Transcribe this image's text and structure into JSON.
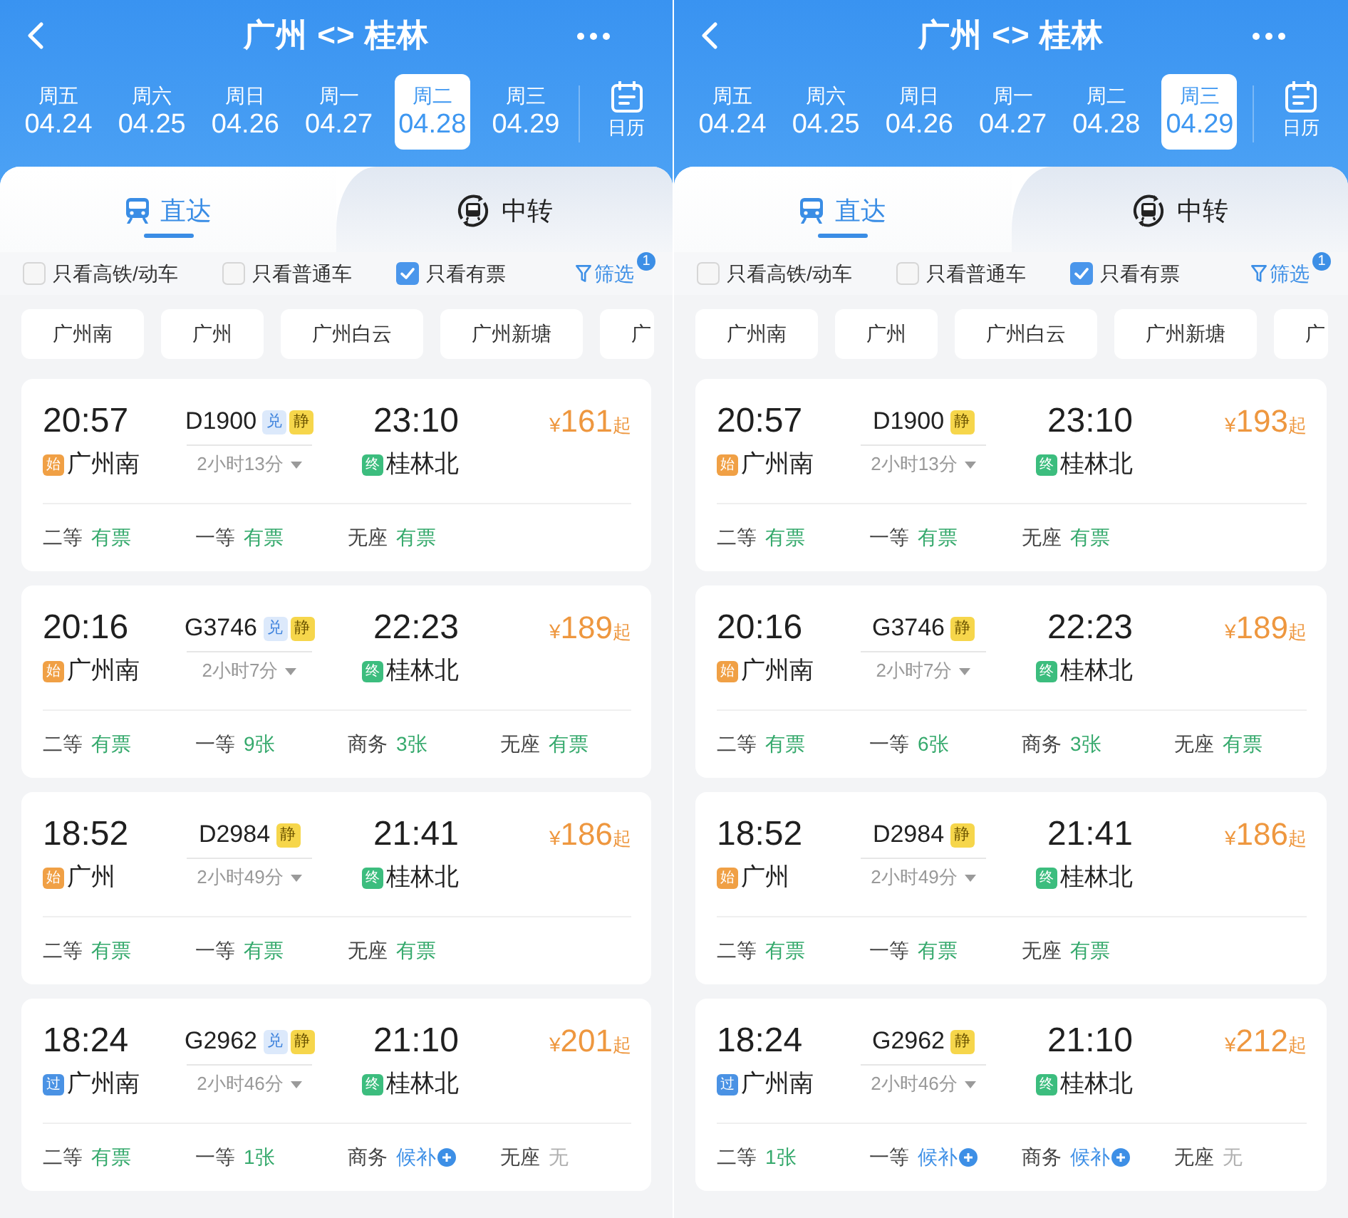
{
  "panels": [
    {
      "header": {
        "title": "广州 <> 桂林"
      },
      "dates": [
        {
          "weekday": "周五",
          "date": "04.24",
          "selected": false
        },
        {
          "weekday": "周六",
          "date": "04.25",
          "selected": false
        },
        {
          "weekday": "周日",
          "date": "04.26",
          "selected": false
        },
        {
          "weekday": "周一",
          "date": "04.27",
          "selected": false
        },
        {
          "weekday": "周二",
          "date": "04.28",
          "selected": true
        },
        {
          "weekday": "周三",
          "date": "04.29",
          "selected": false
        }
      ],
      "calendar": {
        "label": "日历"
      },
      "tabs": [
        {
          "kind": "direct",
          "label": "直达",
          "selected": true
        },
        {
          "kind": "transfer",
          "label": "中转",
          "selected": false
        }
      ],
      "filters": [
        {
          "label": "只看高铁/动车",
          "checked": false
        },
        {
          "label": "只看普通车",
          "checked": false
        },
        {
          "label": "只看有票",
          "checked": true
        }
      ],
      "filter_button": {
        "label": "筛选",
        "badge": "1"
      },
      "stations": [
        {
          "label": "广州南",
          "selected": false
        },
        {
          "label": "广州",
          "selected": false
        },
        {
          "label": "广州白云",
          "selected": false
        },
        {
          "label": "广州新塘",
          "selected": false
        },
        {
          "label": "广",
          "selected": false
        }
      ],
      "trains": [
        {
          "depart": "20:57",
          "from": {
            "tag": "始",
            "kind": "origin",
            "station": "广州南"
          },
          "number": "D1900",
          "badges": [
            {
              "kind": "exchange",
              "text": "兑"
            },
            {
              "kind": "quiet",
              "text": "静"
            }
          ],
          "duration": "2小时13分",
          "arrive": "23:10",
          "to": {
            "tag": "终",
            "kind": "terminal",
            "station": "桂林北"
          },
          "price": {
            "currency": "¥",
            "amount": "161",
            "suffix": "起"
          },
          "seats": [
            {
              "class": "二等",
              "status": "有票",
              "kind": "available"
            },
            {
              "class": "一等",
              "status": "有票",
              "kind": "available"
            },
            {
              "class": "无座",
              "status": "有票",
              "kind": "available"
            }
          ]
        },
        {
          "depart": "20:16",
          "from": {
            "tag": "始",
            "kind": "origin",
            "station": "广州南"
          },
          "number": "G3746",
          "badges": [
            {
              "kind": "exchange",
              "text": "兑"
            },
            {
              "kind": "quiet",
              "text": "静"
            }
          ],
          "duration": "2小时7分",
          "arrive": "22:23",
          "to": {
            "tag": "终",
            "kind": "terminal",
            "station": "桂林北"
          },
          "price": {
            "currency": "¥",
            "amount": "189",
            "suffix": "起"
          },
          "seats": [
            {
              "class": "二等",
              "status": "有票",
              "kind": "available"
            },
            {
              "class": "一等",
              "status": "9张",
              "kind": "available"
            },
            {
              "class": "商务",
              "status": "3张",
              "kind": "available"
            },
            {
              "class": "无座",
              "status": "有票",
              "kind": "available"
            }
          ]
        },
        {
          "depart": "18:52",
          "from": {
            "tag": "始",
            "kind": "origin",
            "station": "广州"
          },
          "number": "D2984",
          "badges": [
            {
              "kind": "quiet",
              "text": "静"
            }
          ],
          "duration": "2小时49分",
          "arrive": "21:41",
          "to": {
            "tag": "终",
            "kind": "terminal",
            "station": "桂林北"
          },
          "price": {
            "currency": "¥",
            "amount": "186",
            "suffix": "起"
          },
          "seats": [
            {
              "class": "二等",
              "status": "有票",
              "kind": "available"
            },
            {
              "class": "一等",
              "status": "有票",
              "kind": "available"
            },
            {
              "class": "无座",
              "status": "有票",
              "kind": "available"
            }
          ]
        },
        {
          "depart": "18:24",
          "from": {
            "tag": "过",
            "kind": "pass",
            "station": "广州南"
          },
          "number": "G2962",
          "badges": [
            {
              "kind": "exchange",
              "text": "兑"
            },
            {
              "kind": "quiet",
              "text": "静"
            }
          ],
          "duration": "2小时46分",
          "arrive": "21:10",
          "to": {
            "tag": "终",
            "kind": "terminal",
            "station": "桂林北"
          },
          "price": {
            "currency": "¥",
            "amount": "201",
            "suffix": "起"
          },
          "seats": [
            {
              "class": "二等",
              "status": "有票",
              "kind": "available"
            },
            {
              "class": "一等",
              "status": "1张",
              "kind": "available"
            },
            {
              "class": "商务",
              "status": "候补",
              "kind": "waitlist"
            },
            {
              "class": "无座",
              "status": "无",
              "kind": "none"
            }
          ]
        }
      ]
    },
    {
      "header": {
        "title": "广州 <> 桂林"
      },
      "dates": [
        {
          "weekday": "周五",
          "date": "04.24",
          "selected": false
        },
        {
          "weekday": "周六",
          "date": "04.25",
          "selected": false
        },
        {
          "weekday": "周日",
          "date": "04.26",
          "selected": false
        },
        {
          "weekday": "周一",
          "date": "04.27",
          "selected": false
        },
        {
          "weekday": "周二",
          "date": "04.28",
          "selected": false
        },
        {
          "weekday": "周三",
          "date": "04.29",
          "selected": true
        }
      ],
      "calendar": {
        "label": "日历"
      },
      "tabs": [
        {
          "kind": "direct",
          "label": "直达",
          "selected": true
        },
        {
          "kind": "transfer",
          "label": "中转",
          "selected": false
        }
      ],
      "filters": [
        {
          "label": "只看高铁/动车",
          "checked": false
        },
        {
          "label": "只看普通车",
          "checked": false
        },
        {
          "label": "只看有票",
          "checked": true
        }
      ],
      "filter_button": {
        "label": "筛选",
        "badge": "1"
      },
      "stations": [
        {
          "label": "广州南",
          "selected": false
        },
        {
          "label": "广州",
          "selected": false
        },
        {
          "label": "广州白云",
          "selected": false
        },
        {
          "label": "广州新塘",
          "selected": false
        },
        {
          "label": "广",
          "selected": false
        }
      ],
      "trains": [
        {
          "depart": "20:57",
          "from": {
            "tag": "始",
            "kind": "origin",
            "station": "广州南"
          },
          "number": "D1900",
          "badges": [
            {
              "kind": "quiet",
              "text": "静"
            }
          ],
          "duration": "2小时13分",
          "arrive": "23:10",
          "to": {
            "tag": "终",
            "kind": "terminal",
            "station": "桂林北"
          },
          "price": {
            "currency": "¥",
            "amount": "193",
            "suffix": "起"
          },
          "seats": [
            {
              "class": "二等",
              "status": "有票",
              "kind": "available"
            },
            {
              "class": "一等",
              "status": "有票",
              "kind": "available"
            },
            {
              "class": "无座",
              "status": "有票",
              "kind": "available"
            }
          ]
        },
        {
          "depart": "20:16",
          "from": {
            "tag": "始",
            "kind": "origin",
            "station": "广州南"
          },
          "number": "G3746",
          "badges": [
            {
              "kind": "quiet",
              "text": "静"
            }
          ],
          "duration": "2小时7分",
          "arrive": "22:23",
          "to": {
            "tag": "终",
            "kind": "terminal",
            "station": "桂林北"
          },
          "price": {
            "currency": "¥",
            "amount": "189",
            "suffix": "起"
          },
          "seats": [
            {
              "class": "二等",
              "status": "有票",
              "kind": "available"
            },
            {
              "class": "一等",
              "status": "6张",
              "kind": "available"
            },
            {
              "class": "商务",
              "status": "3张",
              "kind": "available"
            },
            {
              "class": "无座",
              "status": "有票",
              "kind": "available"
            }
          ]
        },
        {
          "depart": "18:52",
          "from": {
            "tag": "始",
            "kind": "origin",
            "station": "广州"
          },
          "number": "D2984",
          "badges": [
            {
              "kind": "quiet",
              "text": "静"
            }
          ],
          "duration": "2小时49分",
          "arrive": "21:41",
          "to": {
            "tag": "终",
            "kind": "terminal",
            "station": "桂林北"
          },
          "price": {
            "currency": "¥",
            "amount": "186",
            "suffix": "起"
          },
          "seats": [
            {
              "class": "二等",
              "status": "有票",
              "kind": "available"
            },
            {
              "class": "一等",
              "status": "有票",
              "kind": "available"
            },
            {
              "class": "无座",
              "status": "有票",
              "kind": "available"
            }
          ]
        },
        {
          "depart": "18:24",
          "from": {
            "tag": "过",
            "kind": "pass",
            "station": "广州南"
          },
          "number": "G2962",
          "badges": [
            {
              "kind": "quiet",
              "text": "静"
            }
          ],
          "duration": "2小时46分",
          "arrive": "21:10",
          "to": {
            "tag": "终",
            "kind": "terminal",
            "station": "桂林北"
          },
          "price": {
            "currency": "¥",
            "amount": "212",
            "suffix": "起"
          },
          "seats": [
            {
              "class": "二等",
              "status": "1张",
              "kind": "available"
            },
            {
              "class": "一等",
              "status": "候补",
              "kind": "waitlist"
            },
            {
              "class": "商务",
              "status": "候补",
              "kind": "waitlist"
            },
            {
              "class": "无座",
              "status": "无",
              "kind": "none"
            }
          ]
        }
      ]
    }
  ]
}
